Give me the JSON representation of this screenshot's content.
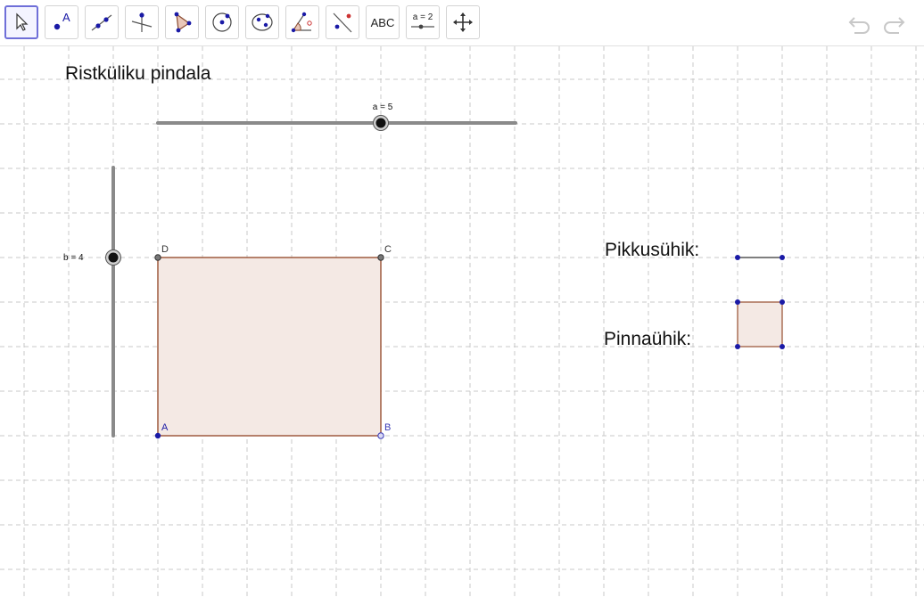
{
  "toolbar": {
    "tools": [
      {
        "name": "move-tool",
        "icon": "cursor-arrow-icon",
        "selected": true
      },
      {
        "name": "point-tool",
        "icon": "point-icon",
        "label": "A"
      },
      {
        "name": "line-tool",
        "icon": "line-icon"
      },
      {
        "name": "perpendicular-line-tool",
        "icon": "perpendicular-icon"
      },
      {
        "name": "polygon-tool",
        "icon": "polygon-icon"
      },
      {
        "name": "circle-tool",
        "icon": "circle-center-point-icon"
      },
      {
        "name": "conic-tool",
        "icon": "ellipse-icon"
      },
      {
        "name": "angle-tool",
        "icon": "angle-icon"
      },
      {
        "name": "reflect-tool",
        "icon": "reflect-icon"
      },
      {
        "name": "text-tool",
        "icon": "text-icon",
        "label": "ABC"
      },
      {
        "name": "slider-tool",
        "icon": "slider-icon",
        "label": "a = 2"
      },
      {
        "name": "move-graphics-tool",
        "icon": "move-cross-icon"
      }
    ],
    "undo_icon": "undo-icon",
    "redo_icon": "redo-icon"
  },
  "graphics": {
    "title": "Ristküliku pindala",
    "slider_a": {
      "label": "a = 5",
      "value": 5
    },
    "slider_b": {
      "label": "b = 4",
      "value": 4
    },
    "points": {
      "A": "A",
      "B": "B",
      "C": "C",
      "D": "D"
    },
    "length_unit_label": "Pikkusühik:",
    "area_unit_label": "Pinnaühik:"
  },
  "colors": {
    "rectangle_fill": "#f4e9e4",
    "rectangle_stroke": "#9e5a3e",
    "point_blue": "#1a1aa6",
    "grid": "#c8c8c8",
    "slider_track": "#8a8a8a",
    "selected_tool_border": "#6f6fd8"
  }
}
